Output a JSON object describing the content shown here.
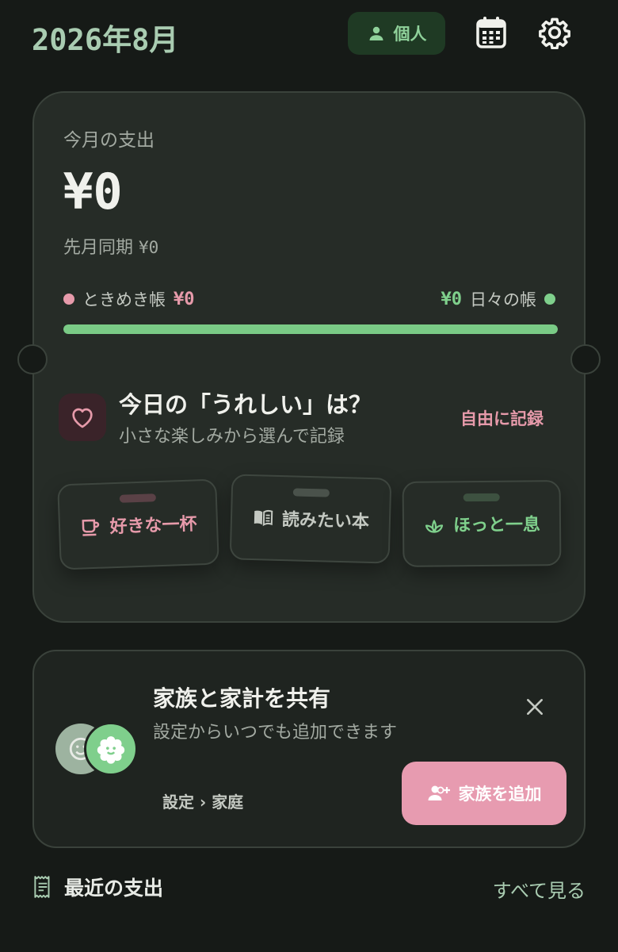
{
  "header": {
    "title": "2026年8月",
    "mode_label": "個人"
  },
  "summary": {
    "label": "今月の支出",
    "amount": "¥0",
    "last_month_label": "先月同期",
    "last_month_value": "¥0",
    "left_name": "ときめき帳",
    "left_value": "¥0",
    "right_name": "日々の帳",
    "right_value": "¥0",
    "bar_fraction_right": 1.0
  },
  "joy": {
    "title": "今日の「うれしい」は？",
    "subtitle": "小さな楽しみから選んで記録",
    "free_link": "自由に記録",
    "chips": [
      {
        "label": "好きな一杯",
        "icon": "cup-icon"
      },
      {
        "label": "読みたい本",
        "icon": "book-icon"
      },
      {
        "label": "ほっと一息",
        "icon": "sprout-icon"
      }
    ]
  },
  "family": {
    "title": "家族と家計を共有",
    "description": "設定からいつでも追加できます",
    "path_a": "設定",
    "path_sep": "›",
    "path_b": "家庭",
    "add_label": "家族を追加"
  },
  "recent": {
    "title": "最近の支出",
    "see_all": "すべて見る"
  },
  "colors": {
    "accent_green": "#7fd08c",
    "accent_pink": "#e69aaa",
    "background": "#161a17",
    "card": "#262c27"
  }
}
